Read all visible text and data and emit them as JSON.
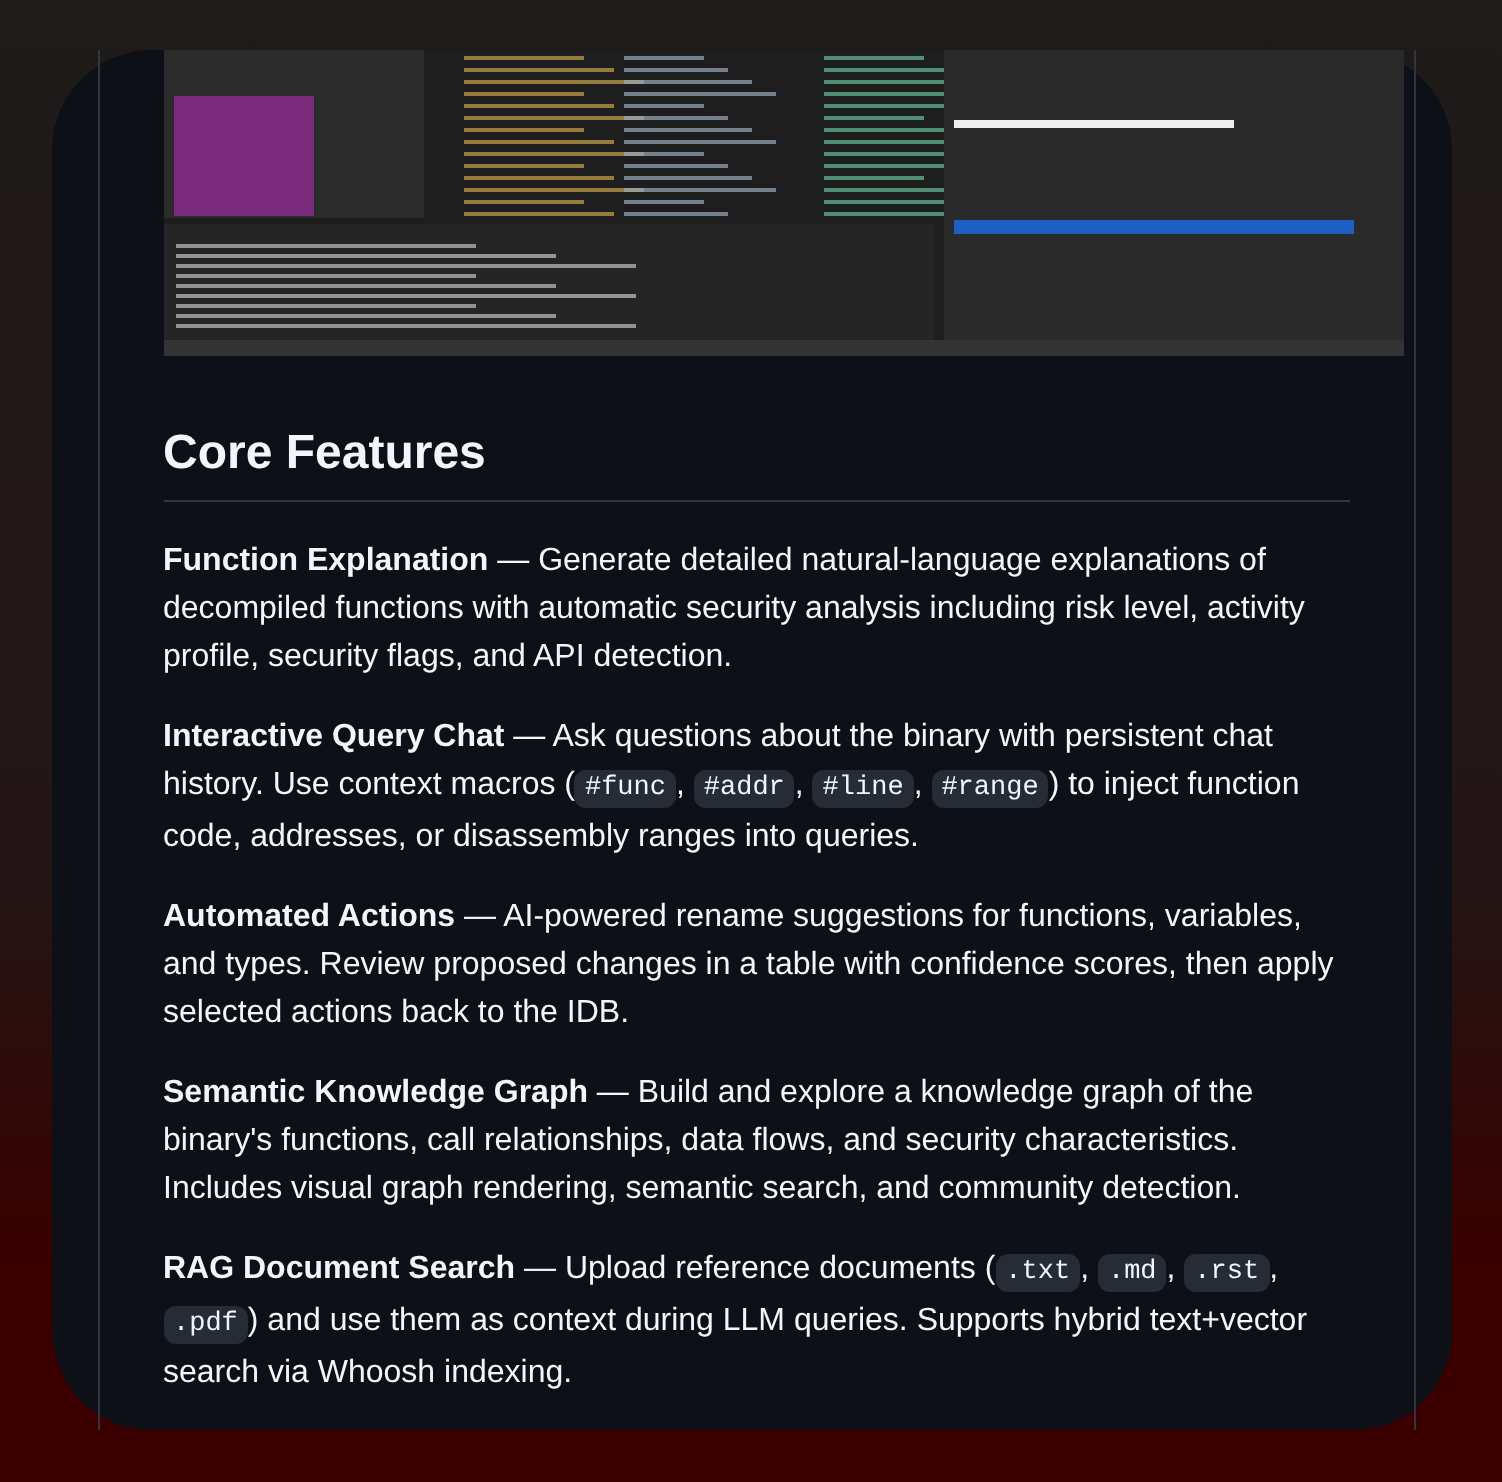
{
  "section": {
    "title": "Core Features"
  },
  "features": [
    {
      "title": "Function Explanation",
      "parts": [
        {
          "kind": "text",
          "text": " — Generate detailed natural-language explanations of decompiled functions with automatic security analysis including risk level, activity profile, security flags, and API detection."
        }
      ]
    },
    {
      "title": "Interactive Query Chat",
      "parts": [
        {
          "kind": "text",
          "text": " — Ask questions about the binary with persistent chat history. Use context macros ("
        },
        {
          "kind": "code",
          "text": "#func"
        },
        {
          "kind": "text",
          "text": ", "
        },
        {
          "kind": "code",
          "text": "#addr"
        },
        {
          "kind": "text",
          "text": ", "
        },
        {
          "kind": "code",
          "text": "#line"
        },
        {
          "kind": "text",
          "text": ", "
        },
        {
          "kind": "code",
          "text": "#range"
        },
        {
          "kind": "text",
          "text": ") to inject function code, addresses, or disassembly ranges into queries."
        }
      ]
    },
    {
      "title": "Automated Actions",
      "parts": [
        {
          "kind": "text",
          "text": " — AI-powered rename suggestions for functions, variables, and types. Review proposed changes in a table with confidence scores, then apply selected actions back to the IDB."
        }
      ]
    },
    {
      "title": "Semantic Knowledge Graph",
      "parts": [
        {
          "kind": "text",
          "text": " — Build and explore a knowledge graph of the binary's functions, call relationships, data flows, and security characteristics. Includes visual graph rendering, semantic search, and community detection."
        }
      ]
    },
    {
      "title": "RAG Document Search",
      "parts": [
        {
          "kind": "text",
          "text": " — Upload reference documents ("
        },
        {
          "kind": "code",
          "text": ".txt"
        },
        {
          "kind": "text",
          "text": ", "
        },
        {
          "kind": "code",
          "text": ".md"
        },
        {
          "kind": "text",
          "text": ", "
        },
        {
          "kind": "code",
          "text": ".rst"
        },
        {
          "kind": "text",
          "text": ", "
        },
        {
          "kind": "code",
          "text": ".pdf"
        },
        {
          "kind": "text",
          "text": ") and use them as context during LLM queries. Supports hybrid text+vector search via Whoosh indexing."
        }
      ]
    }
  ]
}
